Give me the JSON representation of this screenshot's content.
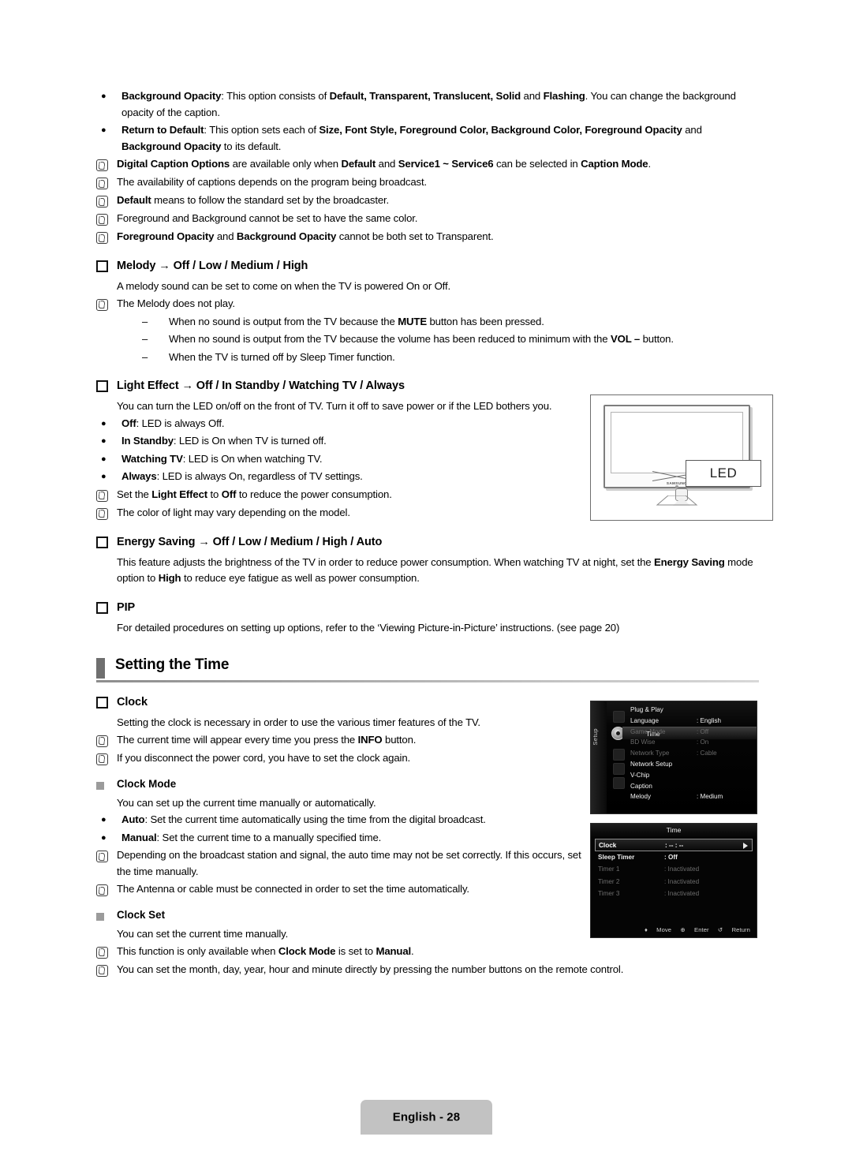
{
  "document": {
    "footer_label": "English - 28"
  },
  "intro_bullets": [
    {
      "marker": "bullet",
      "html": "<b>Background Opacity</b>: This option consists of <b>Default, Transparent, Translucent, Solid</b> and <b>Flashing</b>. You can change the background opacity of the caption."
    },
    {
      "marker": "bullet",
      "html": "<b>Return to Default</b>: This option sets each of <b>Size, Font Style, Foreground Color, Background Color, Foreground Opacity</b> and <b>Background Opacity</b> to its default."
    }
  ],
  "intro_notes": [
    {
      "html": "<b>Digital Caption Options</b> are available only when <b>Default</b> and <b>Service1 ~ Service6</b> can be selected in <b>Caption Mode</b>."
    },
    {
      "html": "The availability of captions depends on the program being broadcast."
    },
    {
      "html": "<b>Default</b> means to follow the standard set by the broadcaster."
    },
    {
      "html": "Foreground and Background cannot be set to have the same color."
    },
    {
      "html": "<b>Foreground Opacity</b> and <b>Background Opacity</b> cannot be both set to Transparent."
    }
  ],
  "melody": {
    "title": "Melody → Off / Low / Medium / High",
    "intro": "A melody sound can be set to come on when the TV is powered On or Off.",
    "note": "The Melody does not play.",
    "dashes": [
      {
        "html": "When no sound is output from the TV because the <b>MUTE</b> button has been pressed."
      },
      {
        "html": "When no sound is output from the TV because the volume has been reduced to minimum with the <b>VOL –</b> button."
      },
      {
        "html": "When the TV is turned off by Sleep Timer function."
      }
    ]
  },
  "light_effect": {
    "title": "Light Effect → Off / In Standby / Watching TV / Always",
    "intro": "You can turn the LED on/off on the front of TV. Turn it off to save power or if the LED bothers you.",
    "bullets": [
      {
        "html": "<b>Off</b>: LED is always Off."
      },
      {
        "html": "<b>In Standby</b>: LED is On when TV is turned off."
      },
      {
        "html": "<b>Watching TV</b>: LED is On when watching TV."
      },
      {
        "html": "<b>Always</b>: LED is always On, regardless of TV settings."
      }
    ],
    "notes": [
      {
        "html": "Set the <b>Light Effect</b> to <b>Off</b> to reduce the power consumption."
      },
      {
        "html": "The color of light may vary depending on the model."
      }
    ],
    "figure": {
      "brand": "SAMSUNG",
      "callout": "LED"
    }
  },
  "energy_saving": {
    "title": "Energy Saving → Off / Low / Medium / High / Auto",
    "body": "This feature adjusts the brightness of the TV in order to reduce power consumption. When watching TV at night, set the <b>Energy Saving</b> mode option to <b>High</b> to reduce eye fatigue as well as power consumption."
  },
  "pip": {
    "title": "PIP",
    "body": "For detailed procedures on setting up options, refer to the ‘Viewing Picture-in-Picture’ instructions. (see page 20)"
  },
  "setting_the_time": {
    "banner": "Setting the Time",
    "clock": {
      "title": "Clock",
      "intro": "Setting the clock is necessary in order to use the various timer features of the TV.",
      "notes": [
        {
          "html": "The current time will appear every time you press the <b>INFO</b> button."
        },
        {
          "html": "If you disconnect the power cord, you have to set the clock again."
        }
      ]
    },
    "clock_mode": {
      "title": "Clock Mode",
      "intro": "You can set up the current time manually or automatically.",
      "bullets": [
        {
          "html": "<b>Auto</b>: Set the current time automatically using the time from the digital broadcast."
        },
        {
          "html": "<b>Manual</b>: Set the current time to a manually specified time."
        }
      ],
      "notes": [
        {
          "html": "Depending on the broadcast station and signal, the auto time may not be set correctly. If this occurs, set the time manually."
        },
        {
          "html": "The Antenna or cable must be connected in order to set the time automatically."
        }
      ]
    },
    "clock_set": {
      "title": "Clock Set",
      "intro": "You can set the current time manually.",
      "notes": [
        {
          "html": "This function is only available when <b>Clock Mode</b> is set to <b>Manual</b>."
        },
        {
          "html": "You can set the month, day, year, hour and minute directly by pressing the number buttons on the remote control."
        }
      ]
    }
  },
  "osd_setup_menu": {
    "side_label": "Setup",
    "rows": [
      {
        "label": "Plug & Play",
        "value": "",
        "state": "bright"
      },
      {
        "label": "Language",
        "value": ": English",
        "state": "bright"
      },
      {
        "label": "Time",
        "value": "",
        "state": "selected"
      },
      {
        "label": "Game Mode",
        "value": ": Off",
        "state": "dim"
      },
      {
        "label": "BD Wise",
        "value": ": On",
        "state": "dim"
      },
      {
        "label": "Network Type",
        "value": ": Cable",
        "state": "dim"
      },
      {
        "label": "Network Setup",
        "value": "",
        "state": "bright"
      },
      {
        "label": "V-Chip",
        "value": "",
        "state": "bright"
      },
      {
        "label": "Caption",
        "value": "",
        "state": "bright"
      },
      {
        "label": "Melody",
        "value": ": Medium",
        "state": "bright"
      }
    ]
  },
  "osd_time_menu": {
    "title": "Time",
    "rows": [
      {
        "label": "Clock",
        "value": ": -- : --",
        "state": "selected"
      },
      {
        "label": "Sleep Timer",
        "value": ": Off",
        "state": "bright"
      },
      {
        "label": "Timer 1",
        "value": ": Inactivated",
        "state": "dim"
      },
      {
        "label": "Timer 2",
        "value": ": Inactivated",
        "state": "dim"
      },
      {
        "label": "Timer 3",
        "value": ": Inactivated",
        "state": "dim"
      }
    ],
    "footer": {
      "move": "Move",
      "enter": "Enter",
      "return": "Return"
    }
  }
}
